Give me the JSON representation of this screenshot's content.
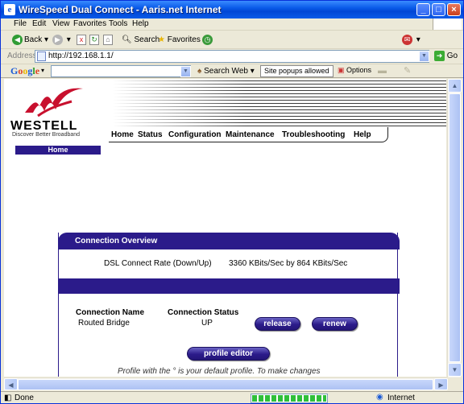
{
  "window": {
    "title": "WireSpeed Dual Connect - Aaris.net Internet"
  },
  "menu": [
    "File",
    "Edit",
    "View",
    "Favorites",
    "Tools",
    "Help"
  ],
  "toolbar": {
    "back": "Back",
    "search": "Search",
    "favorites": "Favorites"
  },
  "address": {
    "label": "Address",
    "url": "http://192.168.1.1/",
    "go": "Go"
  },
  "google": {
    "logo": "Google",
    "search_web": "Search Web",
    "popups": "Site popups allowed",
    "options": "Options"
  },
  "brand": {
    "name": "WESTELL",
    "tagline": "Discover Better Broadband"
  },
  "nav": [
    "Home",
    "Status",
    "Configuration",
    "Maintenance",
    "Troubleshooting",
    "Help"
  ],
  "section": {
    "current": "Home"
  },
  "overview": {
    "title": "Connection Overview",
    "rate_label": "DSL Connect Rate (Down/Up)",
    "rate_value": "3360 KBits/Sec by 864 KBits/Sec",
    "col_name": "Connection Name",
    "col_status": "Connection Status",
    "conn_name": "Routed Bridge",
    "conn_status": "UP",
    "release": "release",
    "renew": "renew",
    "profile_editor": "profile editor",
    "note": "Profile with the ° is your default profile. To make changes"
  },
  "status": {
    "left": "Done",
    "zone": "Internet",
    "progress": 1.0
  },
  "colors": {
    "brand_purple": "#2b1b8a",
    "logo_red": "#c8102e",
    "xp_blue": "#0a5be8"
  }
}
